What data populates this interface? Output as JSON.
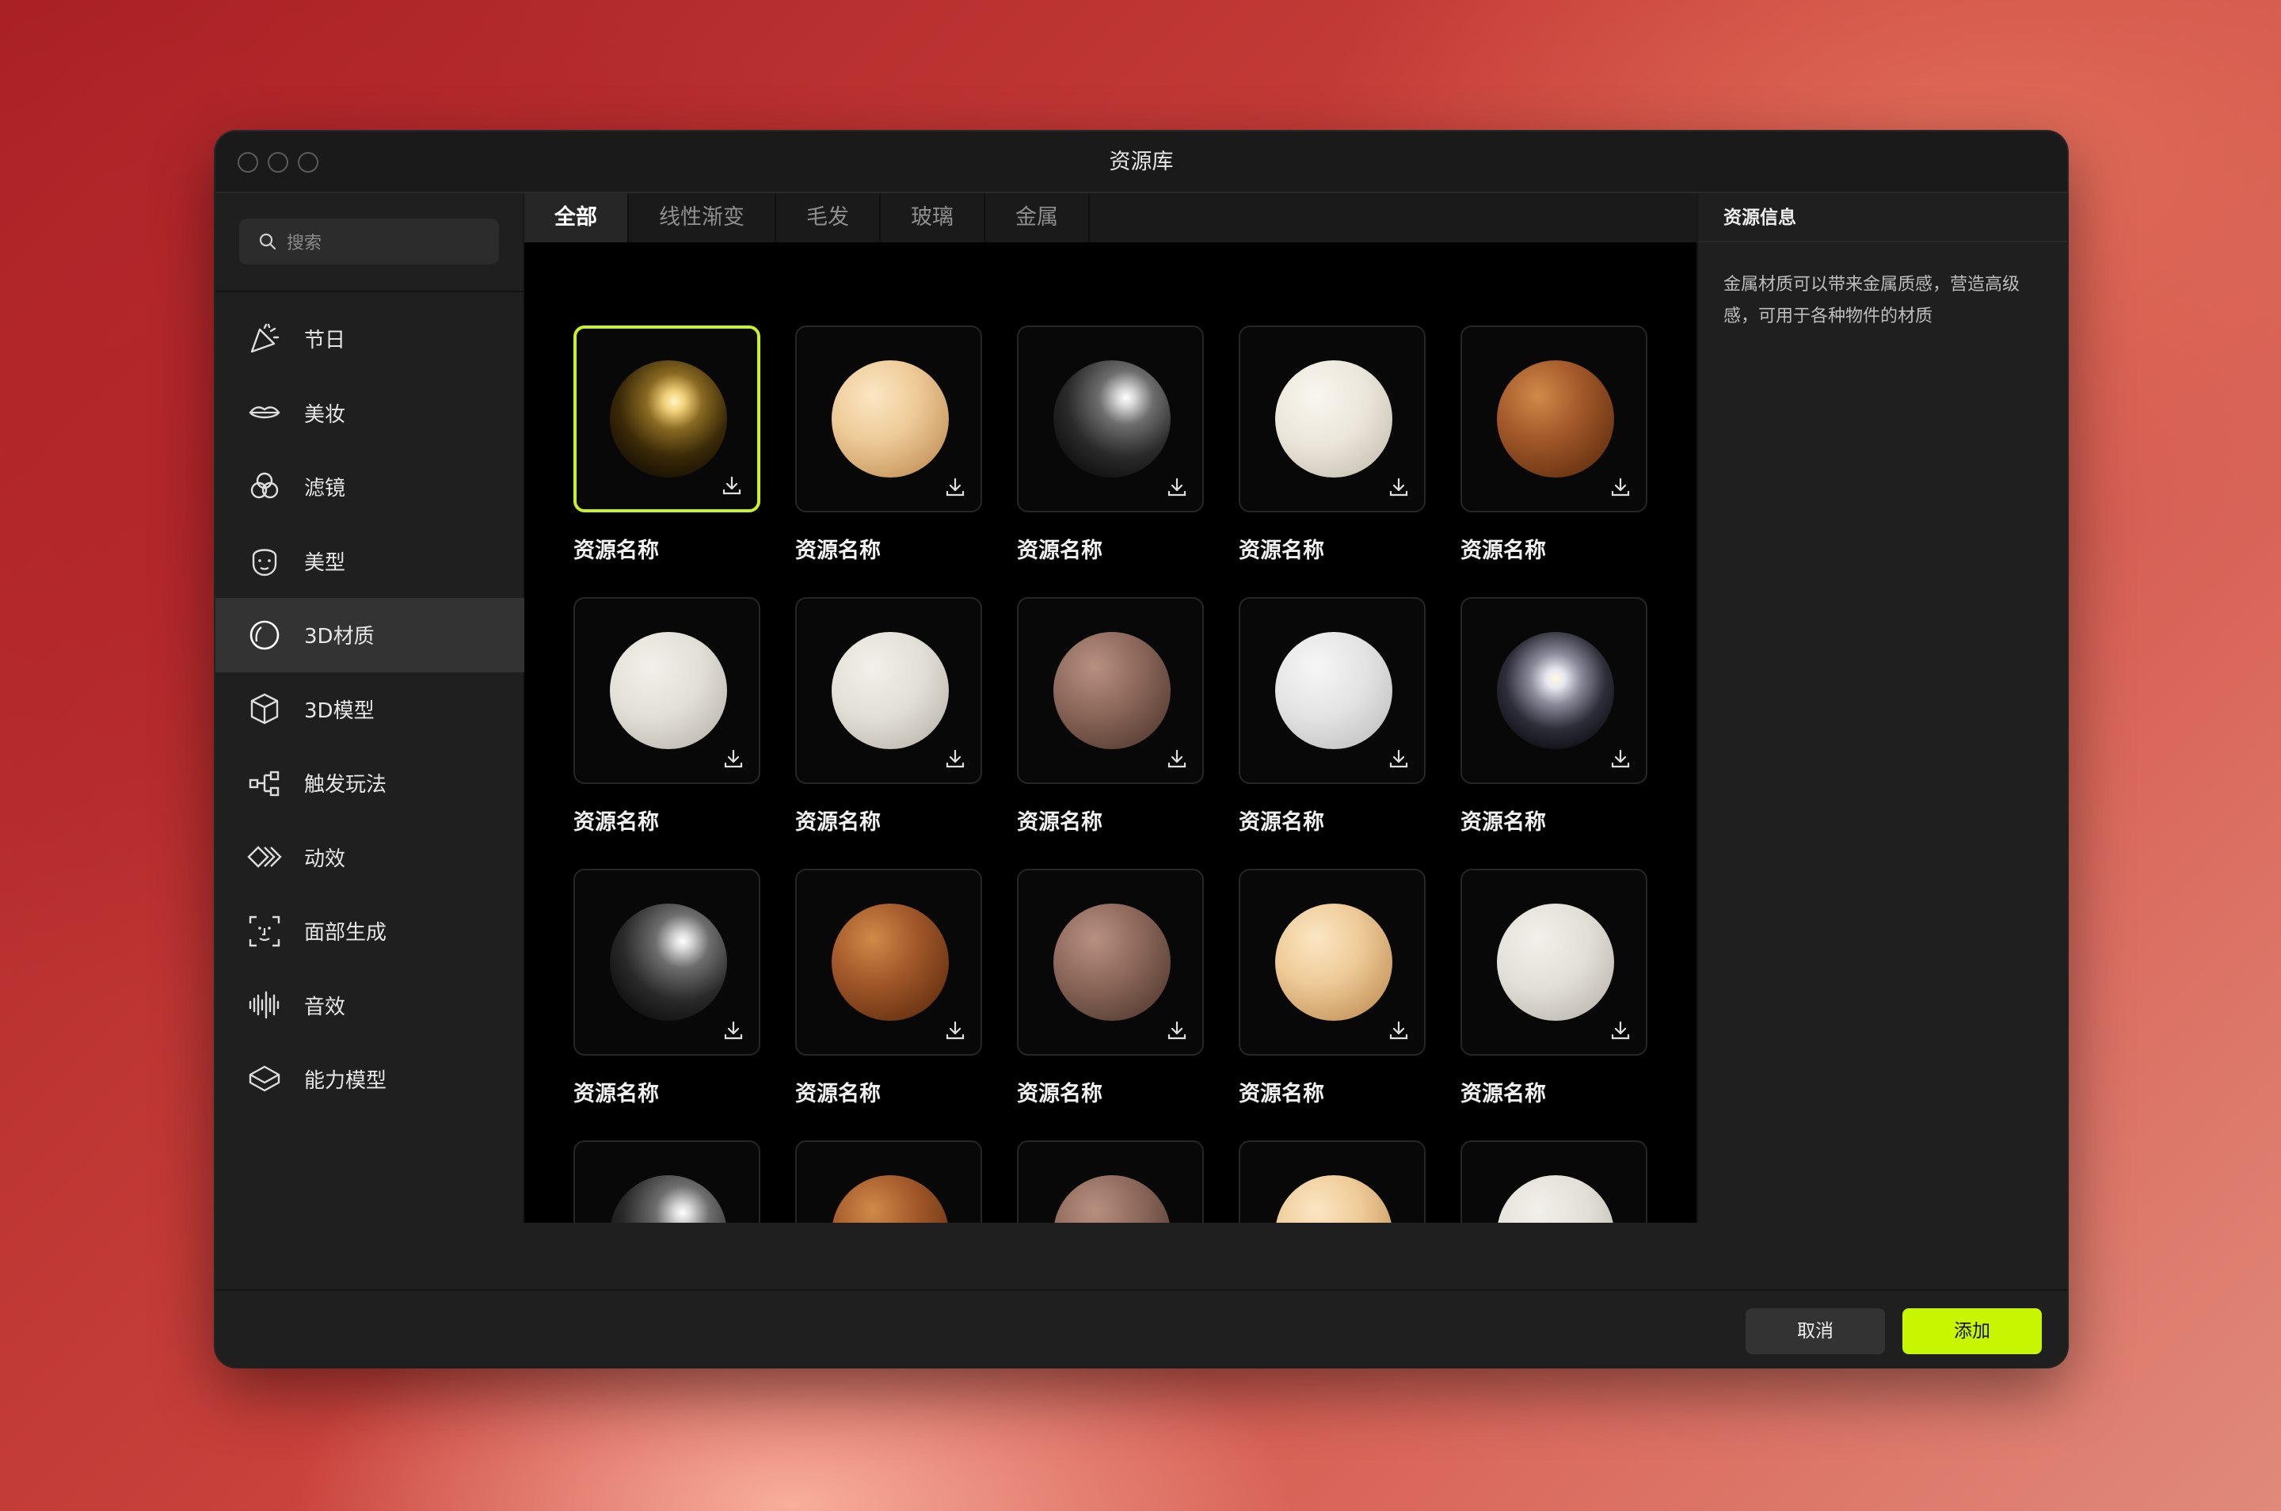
{
  "window": {
    "title": "资源库"
  },
  "search": {
    "placeholder": "搜索"
  },
  "sidebar": {
    "items": [
      {
        "label": "节日",
        "icon": "party-popper-icon"
      },
      {
        "label": "美妆",
        "icon": "lips-icon"
      },
      {
        "label": "滤镜",
        "icon": "filter-circles-icon"
      },
      {
        "label": "美型",
        "icon": "face-icon"
      },
      {
        "label": "3D材质",
        "icon": "material-sphere-icon",
        "active": true
      },
      {
        "label": "3D模型",
        "icon": "cube-icon"
      },
      {
        "label": "触发玩法",
        "icon": "trigger-flow-icon"
      },
      {
        "label": "动效",
        "icon": "motion-icon"
      },
      {
        "label": "面部生成",
        "icon": "face-scan-icon"
      },
      {
        "label": "音效",
        "icon": "audio-wave-icon"
      },
      {
        "label": "能力模型",
        "icon": "layers-icon"
      }
    ]
  },
  "tabs": [
    {
      "label": "全部",
      "active": true
    },
    {
      "label": "线性渐变"
    },
    {
      "label": "毛发"
    },
    {
      "label": "玻璃"
    },
    {
      "label": "金属"
    }
  ],
  "grid": {
    "item_name": "资源名称",
    "rows": [
      [
        "gold",
        "cream",
        "chrome",
        "white",
        "wood"
      ],
      [
        "lightgray",
        "lightgray",
        "rosewood",
        "snow",
        "mirror"
      ],
      [
        "chrome",
        "wood",
        "rosewood",
        "cream",
        "lightgray"
      ],
      [
        "chrome",
        "wood",
        "rosewood",
        "cream",
        "lightgray"
      ]
    ],
    "selected_index": 0
  },
  "materials": {
    "gold": "radial-gradient(circle at 55% 35%, #fff4c8 0%, #f2d27a 10%, #8a6a22 28%, #3b2a08 55%, #120c02 85%)",
    "cream": "radial-gradient(circle at 35% 30%, #fbe6c3 0%, #eecb98 40%, #c99a62 80%, #8a6238 100%)",
    "chrome": "radial-gradient(circle at 62% 32%, #ffffff 0%, #d8d8d8 8%, #6e6e6e 25%, #2a2a2a 55%, #0c0c0c 85%)",
    "white": "radial-gradient(circle at 35% 30%, #f8f6ee 0%, #ebe6da 45%, #c9c3b5 85%, #9a958a 100%)",
    "wood": "radial-gradient(circle at 35% 30%, #d08a48 0%, #a2582a 40%, #6b3512 80%, #3a1a06 100%)",
    "lightgray": "radial-gradient(circle at 35% 30%, #f2f0ea 0%, #e2dfd7 45%, #bebab1 85%, #8f8b83 100%)",
    "rosewood": "radial-gradient(circle at 35% 30%, #b89080 0%, #8e6a5c 40%, #5e4238 80%, #33231d 100%)",
    "snow": "radial-gradient(circle at 35% 30%, #f6f6f6 0%, #e3e3e3 45%, #c3c3c3 85%, #999 100%)",
    "mirror": "radial-gradient(circle at 50% 40%, #fff8e0 0%, #e8e8f0 10%, #8a8a9a 28%, #2e2e3a 55%, #0b0b12 85%)"
  },
  "info": {
    "title": "资源信息",
    "description": "金属材质可以带来金属质感，营造高级感，可用于各种物件的材质"
  },
  "footer": {
    "cancel_label": "取消",
    "add_label": "添加"
  }
}
